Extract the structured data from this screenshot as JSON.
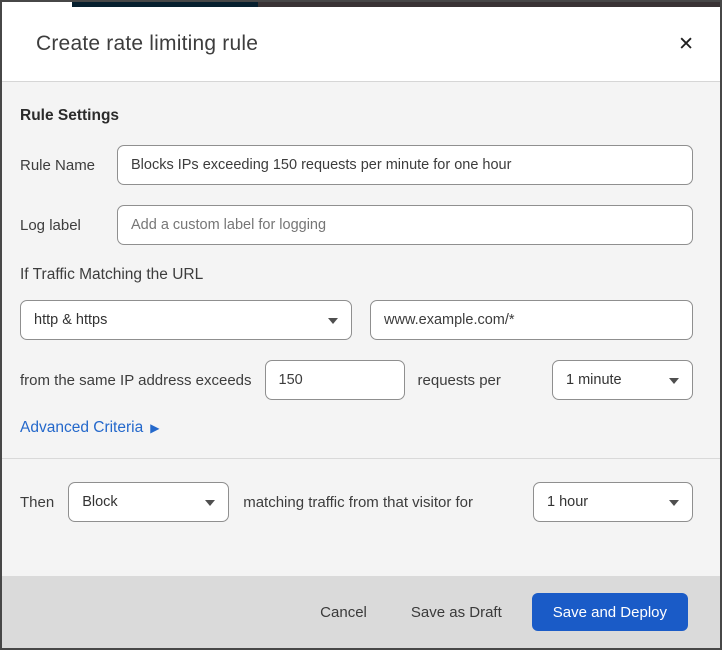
{
  "top_strip": {
    "navy_segment_color": "#07202f",
    "dark_segment_color": "#393334"
  },
  "dialog": {
    "title": "Create rate limiting rule",
    "close_glyph": "✕",
    "section_heading": "Rule Settings",
    "rule_name": {
      "label": "Rule Name",
      "value": "Blocks IPs exceeding 150 requests per minute for one hour"
    },
    "log_label": {
      "label": "Log label",
      "placeholder": "Add a custom label for logging"
    },
    "traffic_heading": "If Traffic Matching the URL",
    "scheme_select": {
      "value": "http & https"
    },
    "url_input": {
      "value": "www.example.com/*"
    },
    "threshold": {
      "prefix": "from the same IP address exceeds",
      "value": "150",
      "middle": "requests per",
      "period": "1 minute"
    },
    "advanced": {
      "label": "Advanced Criteria",
      "icon": "▶"
    },
    "then": {
      "label": "Then",
      "action": "Block",
      "middle": "matching traffic from that visitor for",
      "duration": "1 hour"
    },
    "footer": {
      "cancel": "Cancel",
      "save_draft": "Save as Draft",
      "save_deploy": "Save and Deploy"
    }
  },
  "colors": {
    "primary_button_blue": "#1a5bc7",
    "link_blue": "#2468cb",
    "footer_background": "#dadada",
    "body_background": "#f4f4f4"
  }
}
